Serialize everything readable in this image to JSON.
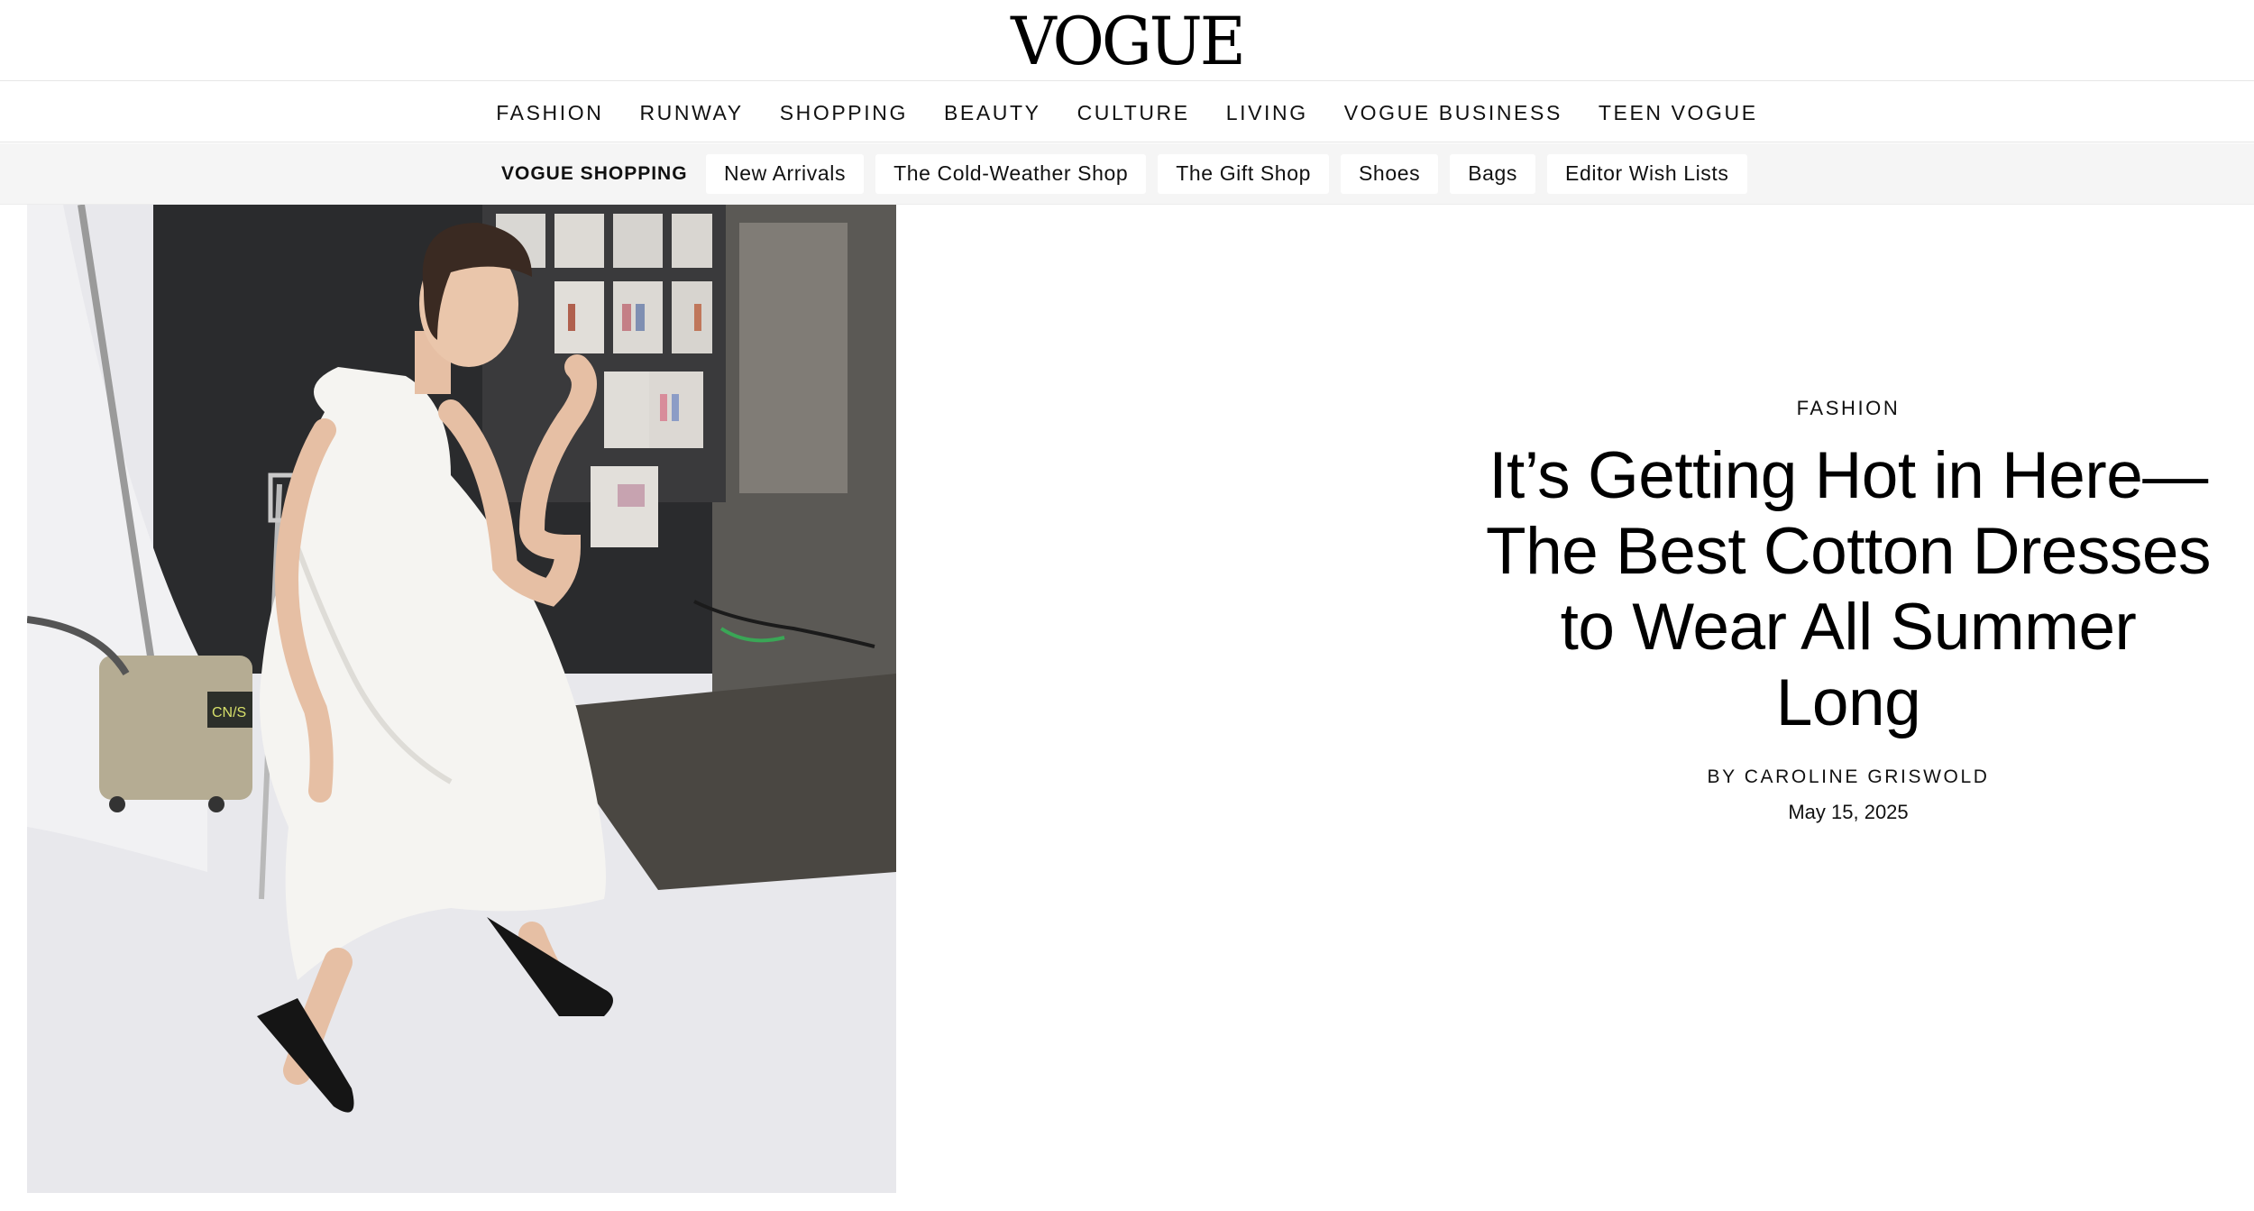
{
  "header": {
    "logo_text": "VOGUE"
  },
  "main_nav": [
    {
      "label": "FASHION"
    },
    {
      "label": "RUNWAY"
    },
    {
      "label": "SHOPPING"
    },
    {
      "label": "BEAUTY"
    },
    {
      "label": "CULTURE"
    },
    {
      "label": "LIVING"
    },
    {
      "label": "VOGUE BUSINESS"
    },
    {
      "label": "TEEN VOGUE"
    }
  ],
  "shopping_nav": {
    "section_label": "VOGUE SHOPPING",
    "links": [
      {
        "label": "New Arrivals"
      },
      {
        "label": "The Cold-Weather Shop"
      },
      {
        "label": "The Gift Shop"
      },
      {
        "label": "Shoes"
      },
      {
        "label": "Bags"
      },
      {
        "label": "Editor Wish Lists"
      }
    ]
  },
  "article": {
    "rubric": "FASHION",
    "headline_lines": [
      "It’s Getting Hot in Here—",
      "The Best Cotton Dresses",
      "to Wear All Summer",
      "Long"
    ],
    "byline_prefix": "BY ",
    "author": "CAROLINE GRISWOLD",
    "date": "May 15, 2025"
  },
  "hero_image": {
    "label_text": "CN/S"
  },
  "colors": {
    "text": "#000000",
    "subnav_background": "#f5f5f5",
    "divider": "#e6e6e6"
  }
}
